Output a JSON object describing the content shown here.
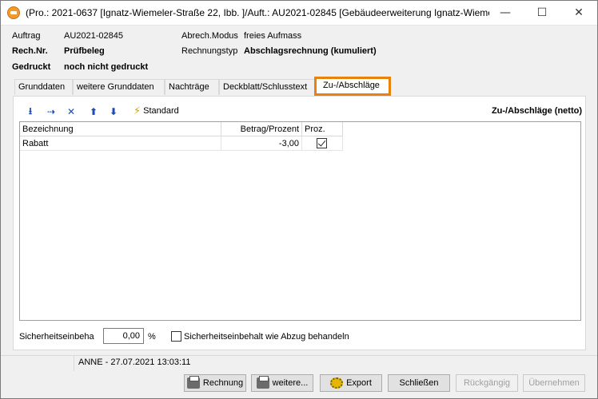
{
  "window": {
    "title": "(Pro.: 2021-0637 [Ignatz-Wiemeler-Straße 22, Ibb. ]/Auft.: AU2021-02845 [Gebäudeerweiterung Ignatz-Wieme...",
    "minimize_glyph": "—",
    "maximize_glyph": "☐",
    "close_glyph": "✕"
  },
  "info": {
    "auftrag_label": "Auftrag",
    "auftrag_value": "AU2021-02845",
    "rechnr_label": "Rech.Nr.",
    "rechnr_value": "Prüfbeleg",
    "gedruckt_label": "Gedruckt",
    "gedruckt_value": "noch nicht gedruckt",
    "abrech_label": "Abrech.Modus",
    "abrech_value": "freies Aufmass",
    "typ_label": "Rechnungstyp",
    "typ_value": "Abschlagsrechnung (kumuliert)"
  },
  "tabs": [
    "Grunddaten",
    "weitere Grunddaten",
    "Nachträge",
    "Deckblatt/Schlusstext",
    "Zu-/Abschläge"
  ],
  "toolbar": {
    "tools": [
      "insert-row-icon",
      "insert-all-icon",
      "delete-icon",
      "move-up-icon",
      "move-down-icon"
    ],
    "glyphs": [
      "⭳",
      "⇢",
      "✕",
      "⬆",
      "⬇"
    ],
    "standard_label": "Standard",
    "panel_title": "Zu-/Abschläge (netto)"
  },
  "grid": {
    "columns": [
      "Bezeichnung",
      "Betrag/Prozent",
      "Proz."
    ],
    "rows": [
      {
        "bezeichnung": "Rabatt",
        "betrag": "-3,00",
        "proz": true
      }
    ]
  },
  "sicherheit": {
    "label": "Sicherheitseinbeha",
    "value": "0,00",
    "unit": "%",
    "checkbox_label": "Sicherheitseinbehalt wie Abzug behandeln",
    "checkbox_checked": false
  },
  "status": {
    "text": "ANNE - 27.07.2021 13:03:11"
  },
  "buttons": {
    "rechnung": "Rechnung",
    "weitere": "weitere...",
    "export": "Export",
    "schliessen": "Schließen",
    "rueckgaengig": "Rückgängig",
    "uebernehmen": "Übernehmen"
  },
  "colors": {
    "accent_tab_border": "#e8820c",
    "icon_blue": "#1e4bb8"
  }
}
